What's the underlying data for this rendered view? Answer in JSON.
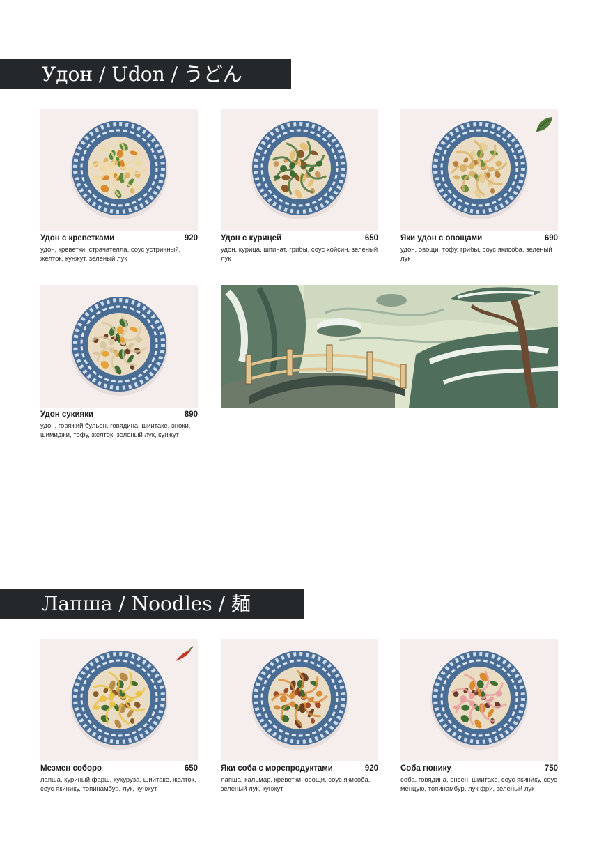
{
  "sections": {
    "udon": {
      "heading": "Удон / Udon / うどん"
    },
    "noodles": {
      "heading": "Лапша / Noodles / 麺"
    }
  },
  "dishes": [
    {
      "name": "Удон с креветками",
      "price": "920",
      "description": "удон, креветки, страчателла, соус устричный, желток, кунжут, зеленый лук",
      "badge": ""
    },
    {
      "name": "Удон с курицей",
      "price": "650",
      "description": "удон, курица, шпинат, грибы, соус хойсин, зеленый лук",
      "badge": ""
    },
    {
      "name": "Яки удон с овощами",
      "price": "690",
      "description": "удон, овощи, тофу, грибы, соус якисоба, зеленый лук",
      "badge": "leaf-icon"
    },
    {
      "name": "Удон сукияки",
      "price": "890",
      "description": "удон, говяжий бульон, говядина, шиитаке, эноки, шимиджи, тофу, желток, зеленый лук, кунжут",
      "badge": ""
    },
    {
      "name": "Мезмен соборо",
      "price": "650",
      "description": "лапша, куриный фарш, кукуруза, шиитаке, желток, соус якинику, топинамбур, лук, кунжут",
      "badge": "chili-pepper-icon"
    },
    {
      "name": "Яки соба с морепродуктами",
      "price": "920",
      "description": "лапша, кальмар, креветки, овощи, соус якисоба, зеленый лук, кунжут",
      "badge": ""
    },
    {
      "name": "Соба гюнику",
      "price": "750",
      "description": "соба, говядина, онсен, шиитаке, соус якинику, соус менцую, топинамбур, лук фри, зеленый лук",
      "badge": ""
    }
  ],
  "colors": {
    "band": "#24282b",
    "photo_bg": "#f6eeec",
    "bowl_blue": "#4a6d96",
    "leaf_green": "#4f7a3a",
    "chili_red": "#c0392b"
  }
}
